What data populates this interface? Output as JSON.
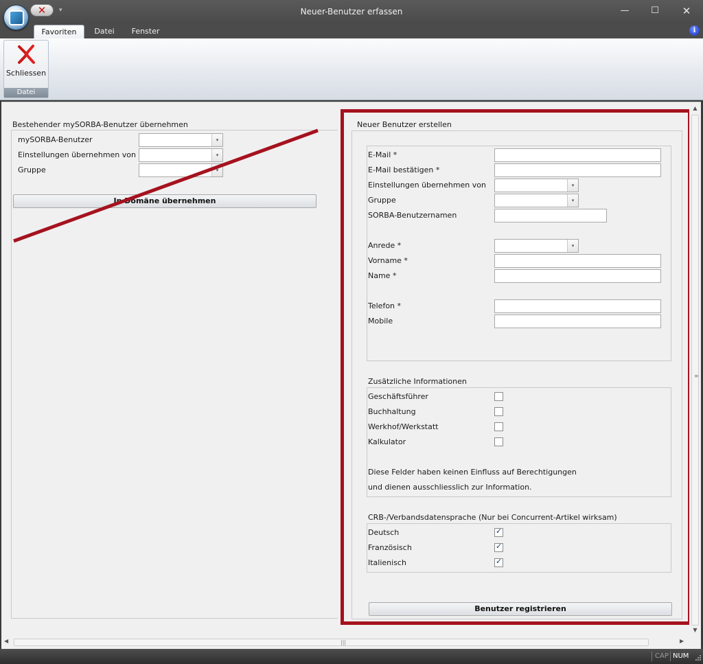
{
  "window": {
    "title": "Neuer-Benutzer erfassen",
    "minimize_glyph": "—",
    "maximize_glyph": "☐",
    "close_glyph": "✕",
    "qat_close_glyph": "✕",
    "qat_more_glyph": "▾"
  },
  "ribbon": {
    "tabs": [
      "Favoriten",
      "Datei",
      "Fenster"
    ],
    "active_tab": "Favoriten",
    "info_glyph": "i",
    "group": {
      "label": "Datei",
      "close_button_label": "Schliessen"
    }
  },
  "left_panel": {
    "title": "Bestehender mySORBA-Benutzer übernehmen",
    "fields": [
      {
        "label": "mySORBA-Benutzer",
        "value": ""
      },
      {
        "label": "Einstellungen übernehmen von",
        "value": ""
      },
      {
        "label": "Gruppe",
        "value": ""
      }
    ],
    "button": "In Domäne übernehmen",
    "dropdown_glyph": "▾"
  },
  "right_panel": {
    "title": "Neuer Benutzer erstellen",
    "fields": {
      "email": {
        "label": "E-Mail *",
        "value": ""
      },
      "email_confirm": {
        "label": "E-Mail bestätigen *",
        "value": ""
      },
      "settings_from": {
        "label": "Einstellungen übernehmen von",
        "value": ""
      },
      "group": {
        "label": "Gruppe",
        "value": ""
      },
      "username": {
        "label": "SORBA-Benutzernamen",
        "value": ""
      },
      "salutation": {
        "label": "Anrede *",
        "value": ""
      },
      "firstname": {
        "label": "Vorname *",
        "value": ""
      },
      "lastname": {
        "label": "Name *",
        "value": ""
      },
      "phone": {
        "label": "Telefon *",
        "value": ""
      },
      "mobile": {
        "label": "Mobile",
        "value": ""
      }
    },
    "additional_info": {
      "title": "Zusätzliche Informationen",
      "items": [
        {
          "label": "Geschäftsführer",
          "checked": false
        },
        {
          "label": "Buchhaltung",
          "checked": false
        },
        {
          "label": "Werkhof/Werkstatt",
          "checked": false
        },
        {
          "label": "Kalkulator",
          "checked": false
        }
      ],
      "note_line1": "Diese Felder haben keinen Einfluss auf Berechtigungen",
      "note_line2": "und dienen ausschliesslich zur Information."
    },
    "language": {
      "title": "CRB-/Verbandsdatensprache (Nur bei Concurrent-Artikel wirksam)",
      "items": [
        {
          "label": "Deutsch",
          "checked": true
        },
        {
          "label": "Französisch",
          "checked": true
        },
        {
          "label": "Italienisch",
          "checked": true
        }
      ]
    },
    "register_button": "Benutzer registrieren"
  },
  "statusbar": {
    "cap": "CAP",
    "num": "NUM"
  },
  "scroll": {
    "up_glyph": "▲",
    "down_glyph": "▼",
    "left_glyph": "◀",
    "right_glyph": "▶"
  },
  "colors": {
    "highlight_frame": "#a5121e",
    "strike_line": "#a5121e",
    "titlebar": "#4f4f4f"
  }
}
